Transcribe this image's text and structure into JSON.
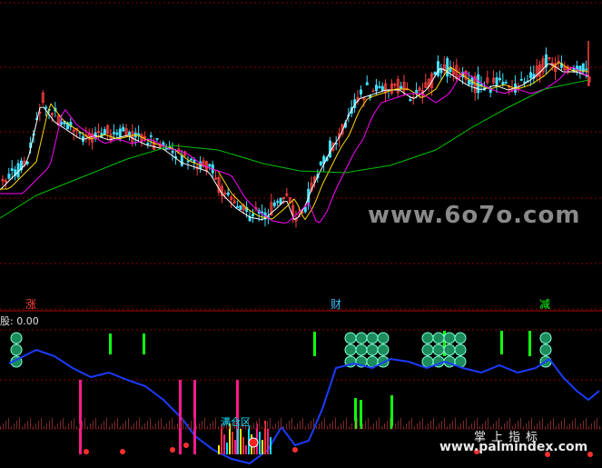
{
  "markers": {
    "m1": "涨",
    "m2": "财",
    "m3": "减"
  },
  "indicator": {
    "label": "股: 0.00",
    "text_in_chart": "满仓区"
  },
  "watermark": {
    "big": "www.6o7o.com",
    "cn": "掌上指标",
    "url": "www.palmindex.com"
  },
  "colors": {
    "background": "#000000",
    "grid": "#8b0000",
    "up_candle": "#ff4040",
    "down_candle": "#40e0ff",
    "ma_short": "#ffffff",
    "ma_mid": "#ffd700",
    "ma_long": "#ff00ff",
    "ma_longest": "#00c000",
    "osc_line": "#1a3cff",
    "bar_pink": "#ff1a8c",
    "bar_green": "#10ff10",
    "bar_yellow": "#ffff00",
    "bar_cyan": "#00e0ff"
  }
}
